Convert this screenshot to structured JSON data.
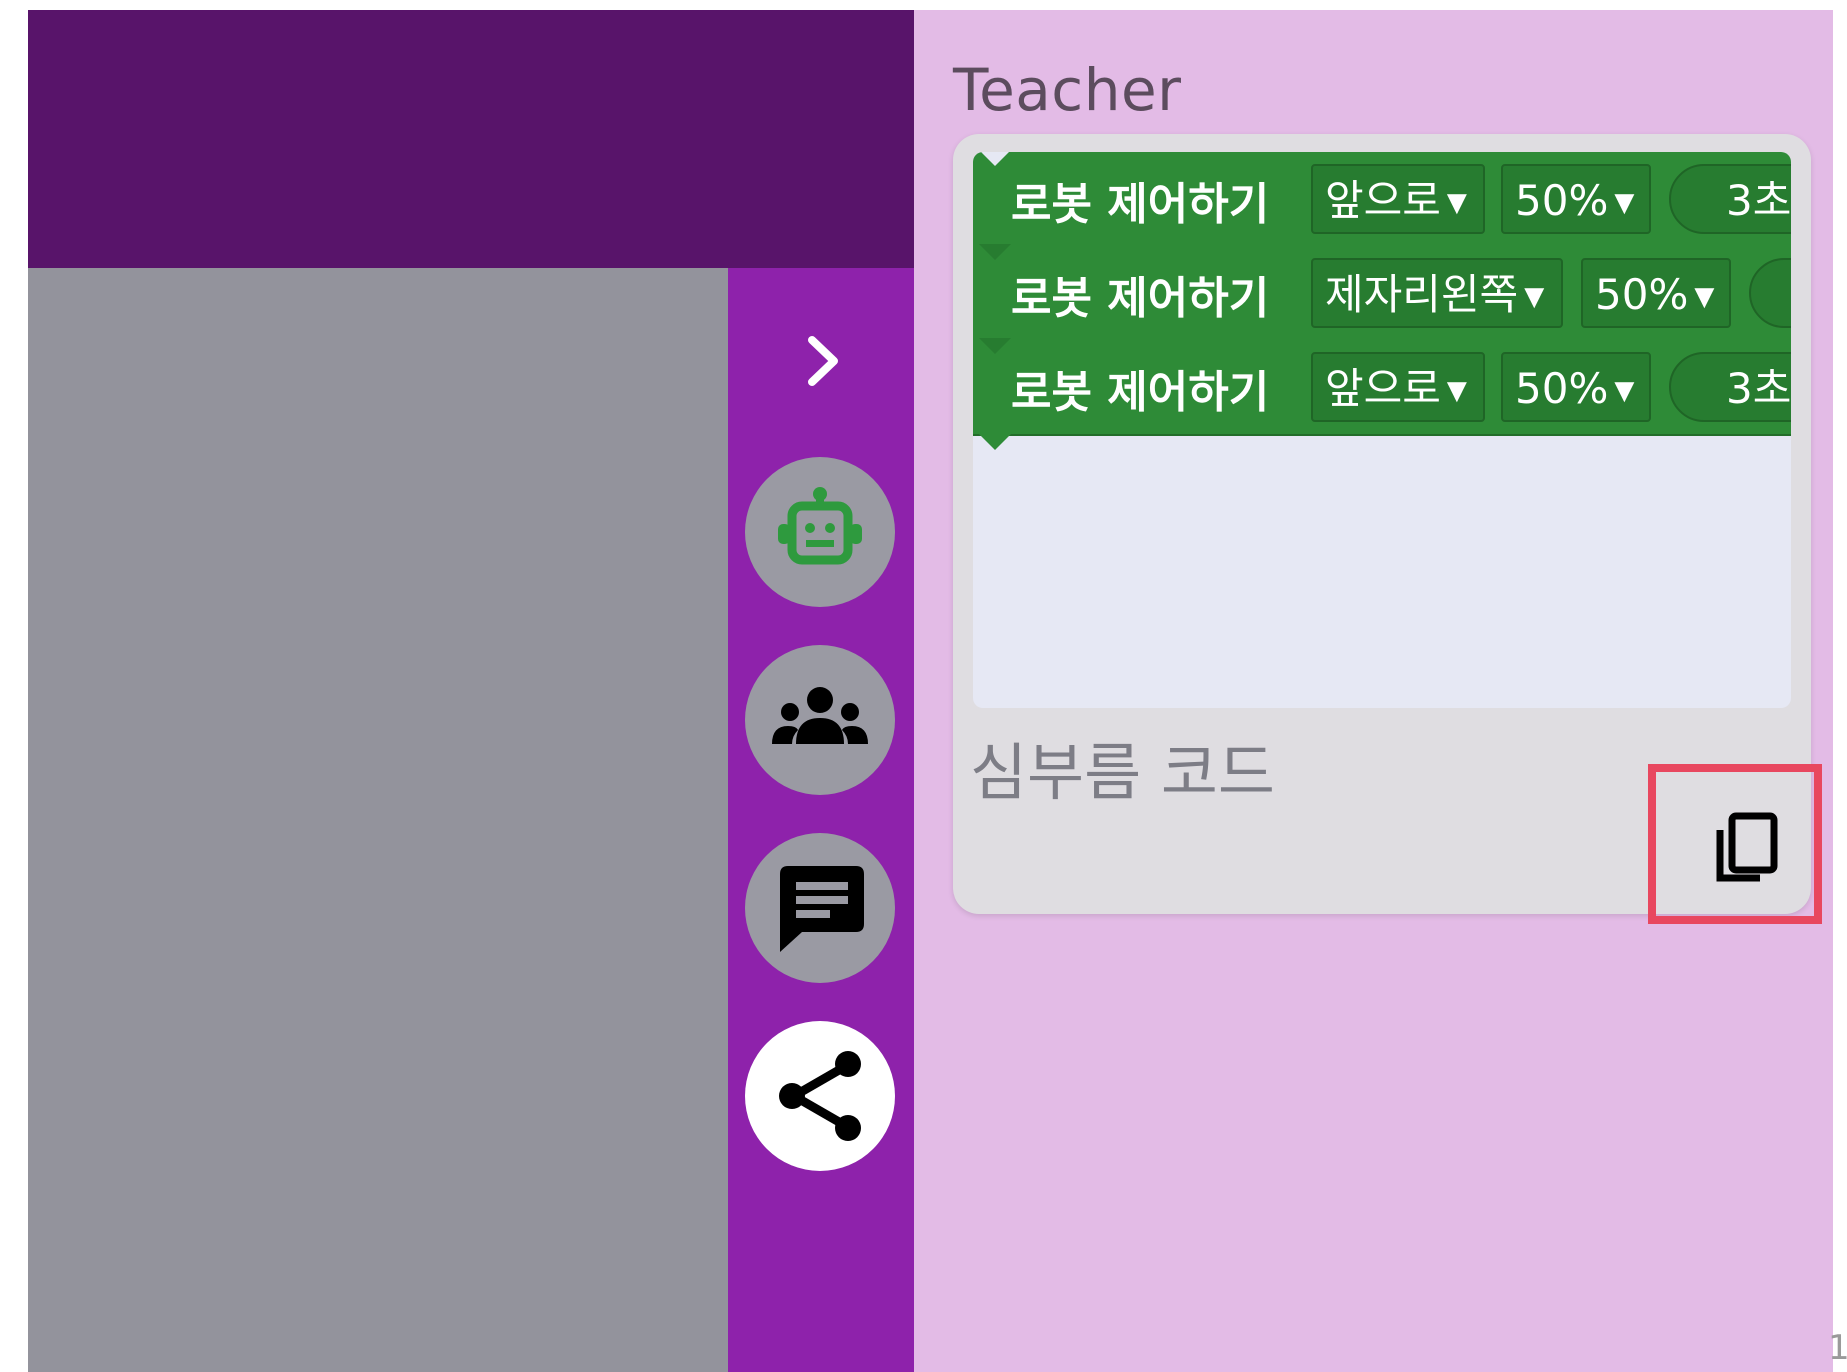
{
  "panel": {
    "title": "Teacher",
    "code_name": "심부름 코드"
  },
  "blocks": [
    {
      "label": "로봇 제어하기",
      "direction": "앞으로",
      "speed": "50%",
      "duration": "3초"
    },
    {
      "label": "로봇 제어하기",
      "direction": "제자리왼쪽",
      "speed": "50%",
      "duration": ""
    },
    {
      "label": "로봇 제어하기",
      "direction": "앞으로",
      "speed": "50%",
      "duration": "3초"
    }
  ],
  "icons": {
    "expand": "chevron-right-icon",
    "robot": "robot-icon",
    "group": "group-icon",
    "chat": "chat-icon",
    "share": "share-icon",
    "copy": "copy-icon"
  },
  "colors": {
    "top_bar": "#58146a",
    "side_rail": "#8e22ab",
    "panel_bg": "#e3bbe6",
    "block_green": "#2e8b37",
    "highlight": "#e8475f"
  },
  "footer": {
    "page_number": "1"
  }
}
